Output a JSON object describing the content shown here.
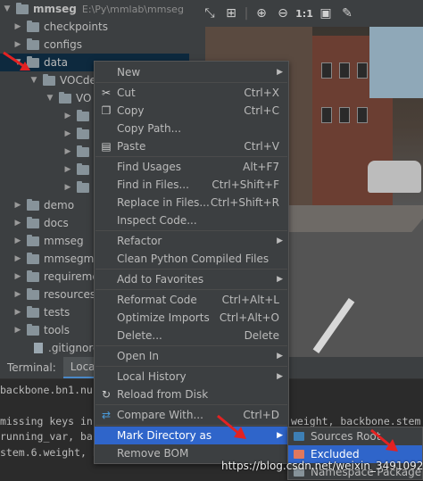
{
  "tree": {
    "project_name": "mmseg",
    "project_path": "E:\\Py\\mmlab\\mmseg",
    "items": [
      {
        "label": "checkpoints"
      },
      {
        "label": "configs"
      },
      {
        "label": "data"
      },
      {
        "label": "VOCde"
      },
      {
        "label": "VO"
      },
      {
        "label": "demo"
      },
      {
        "label": "docs"
      },
      {
        "label": "mmseg"
      },
      {
        "label": "mmsegm"
      },
      {
        "label": "requireme"
      },
      {
        "label": "resources"
      },
      {
        "label": "tests"
      },
      {
        "label": "tools"
      },
      {
        "label": ".gitignore"
      }
    ]
  },
  "viewer_toolbar": {
    "zoom_label": "1:1"
  },
  "bottom_tabs": [
    {
      "label": "Terminal:"
    },
    {
      "label": "Local"
    }
  ],
  "terminal": {
    "lines": [
      "  backbone.bn1.nu",
      "",
      "missing keys in s",
      "running_var, back",
      "stem.6.weight, ba"
    ],
    "right_text": "weight, backbone.stem.1"
  },
  "context_menu": {
    "items": [
      {
        "label": "New",
        "shortcut": "",
        "arrow": true
      },
      {
        "label": "Cut",
        "shortcut": "Ctrl+X",
        "icon": "scissors-icon"
      },
      {
        "label": "Copy",
        "shortcut": "Ctrl+C",
        "icon": "copy-icon"
      },
      {
        "label": "Copy Path...",
        "shortcut": ""
      },
      {
        "label": "Paste",
        "shortcut": "Ctrl+V",
        "icon": "paste-icon"
      },
      {
        "label": "Find Usages",
        "shortcut": "Alt+F7"
      },
      {
        "label": "Find in Files...",
        "shortcut": "Ctrl+Shift+F"
      },
      {
        "label": "Replace in Files...",
        "shortcut": "Ctrl+Shift+R"
      },
      {
        "label": "Inspect Code...",
        "shortcut": ""
      },
      {
        "label": "Refactor",
        "shortcut": "",
        "arrow": true
      },
      {
        "label": "Clean Python Compiled Files",
        "shortcut": ""
      },
      {
        "label": "Add to Favorites",
        "shortcut": "",
        "arrow": true
      },
      {
        "label": "Reformat Code",
        "shortcut": "Ctrl+Alt+L"
      },
      {
        "label": "Optimize Imports",
        "shortcut": "Ctrl+Alt+O"
      },
      {
        "label": "Delete...",
        "shortcut": "Delete"
      },
      {
        "label": "Open In",
        "shortcut": "",
        "arrow": true
      },
      {
        "label": "Local History",
        "shortcut": "",
        "arrow": true
      },
      {
        "label": "Reload from Disk",
        "shortcut": "",
        "icon": "reload-icon"
      },
      {
        "label": "Compare With...",
        "shortcut": "Ctrl+D",
        "icon": "compare-icon"
      },
      {
        "label": "Mark Directory as",
        "shortcut": "",
        "arrow": true,
        "selected": true
      },
      {
        "label": "Remove BOM",
        "shortcut": ""
      }
    ]
  },
  "submenu": {
    "items": [
      {
        "label": "Sources Root",
        "color": "#3d7fb5"
      },
      {
        "label": "Excluded",
        "color": "#e0785e",
        "selected": true
      },
      {
        "label": "Namespace Package",
        "color": "#87939a"
      }
    ]
  },
  "watermark": "https://blog.csdn.net/weixin_34910922",
  "colors": {
    "menu_bg": "#3c3f41",
    "selection": "#2f65ca",
    "excluded_folder": "#e0785e",
    "sources_folder": "#3d7fb5",
    "annotation_arrow": "#e32222"
  }
}
